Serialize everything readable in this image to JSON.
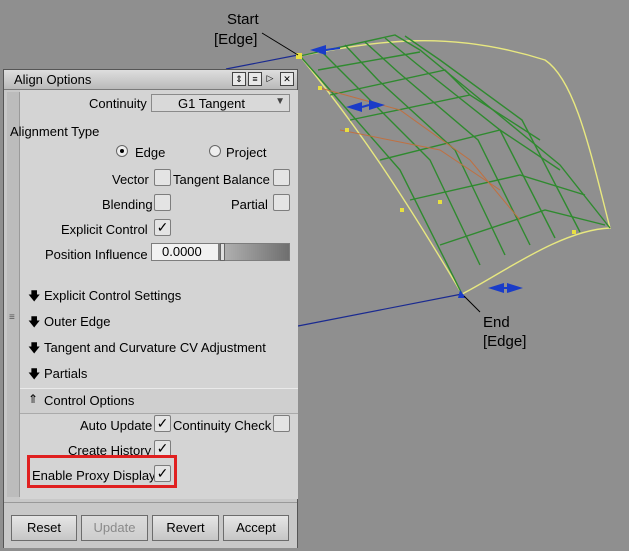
{
  "viewport": {
    "start_label": [
      "Start",
      "[Edge]"
    ],
    "end_label": [
      "End",
      "[Edge]"
    ]
  },
  "panel": {
    "title": "Align Options",
    "title_icons": [
      "dock-icon",
      "list-icon",
      "play-icon",
      "close-icon"
    ],
    "continuity": {
      "label": "Continuity",
      "value": "G1 Tangent"
    },
    "alignment_type": {
      "label": "Alignment Type",
      "options": [
        {
          "label": "Edge",
          "selected": true
        },
        {
          "label": "Project",
          "selected": false
        }
      ]
    },
    "checks": {
      "vector": {
        "label": "Vector",
        "checked": false
      },
      "tangent_balance": {
        "label": "Tangent Balance",
        "checked": false
      },
      "blending": {
        "label": "Blending",
        "checked": false
      },
      "partial": {
        "label": "Partial",
        "checked": false
      },
      "explicit_control": {
        "label": "Explicit Control",
        "checked": true
      }
    },
    "position_influence": {
      "label": "Position Influence",
      "value": "0.0000",
      "slider_fraction": 0.0
    },
    "sections": [
      {
        "label": "Explicit Control Settings",
        "expanded": false
      },
      {
        "label": "Outer Edge",
        "expanded": false
      },
      {
        "label": "Tangent and Curvature CV Adjustment",
        "expanded": false
      },
      {
        "label": "Partials",
        "expanded": false
      },
      {
        "label": "Control Options",
        "expanded": true
      }
    ],
    "control_options": {
      "auto_update": {
        "label": "Auto Update",
        "checked": true
      },
      "continuity_check": {
        "label": "Continuity Check",
        "checked": false
      },
      "create_history": {
        "label": "Create History",
        "checked": true
      },
      "enable_proxy_display": {
        "label": "Enable Proxy Display",
        "checked": true
      }
    },
    "buttons": {
      "reset": "Reset",
      "update": "Update",
      "revert": "Revert",
      "accept": "Accept"
    }
  },
  "colors": {
    "viewport_bg": "#8f8f8f",
    "surface_green": "#2f8a2f",
    "highlight_red": "#e02020",
    "arrow_blue": "#1a3cc8"
  }
}
